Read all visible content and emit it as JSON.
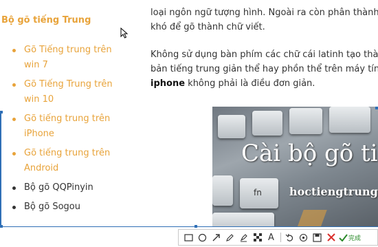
{
  "sidebar": {
    "title": "Bộ gõ tiếng Trung",
    "items": [
      {
        "label": "Gõ Tiếng trung trên win 7",
        "line1": "Gõ Tiếng trung trên",
        "line2": "win 7",
        "color": "#e8a33a"
      },
      {
        "label": "Gõ Tiếng Trung trên win 10",
        "line1": "Gõ Tiếng Trung trên",
        "line2": "win 10",
        "color": "#e8a33a"
      },
      {
        "label": "Gõ tiếng trung trên iPhone",
        "line1": "Gõ tiếng trung trên",
        "line2": "iPhone",
        "color": "#e8a33a"
      },
      {
        "label": "Gõ tiếng trung trên Android",
        "line1": "Gõ tiếng trung trên",
        "line2": "Android",
        "color": "#e8a33a"
      },
      {
        "label": "Bộ gõ QQPinyin",
        "color": "#333333"
      },
      {
        "label": "Bộ gõ Sogou",
        "color": "#333333"
      }
    ]
  },
  "article": {
    "p1_line1": "loại ngôn ngữ tượng hình. Ngoài ra còn phân thành",
    "p1_line2": "khó để gõ thành chữ viết.",
    "p2_line1": "Không sử dụng bàn phím các chữ cái latinh tạo thành",
    "p2_line2": "bản tiếng trung giản thể hay phồn thể trên máy tính,",
    "p2_bold": "iphone",
    "p2_line3_rest": " không phải là điều đơn giản."
  },
  "promo_image": {
    "title": "Cài bộ gõ tiế",
    "subtitle": "hoctiengtrungt",
    "key_label": "fn"
  },
  "toolbar": {
    "tools": [
      "rectangle-icon",
      "ellipse-icon",
      "arrow-icon",
      "pen-icon",
      "highlighter-icon",
      "mosaic-icon",
      "text-icon",
      "undo-icon",
      "pin-icon",
      "save-icon",
      "cancel-icon",
      "done-icon"
    ],
    "text_tool": "A",
    "done_label": "完成"
  },
  "colors": {
    "accent": "#e8a33a",
    "selection": "#2f6fb6",
    "cancel": "#d9302c",
    "done": "#2a8a2a"
  }
}
